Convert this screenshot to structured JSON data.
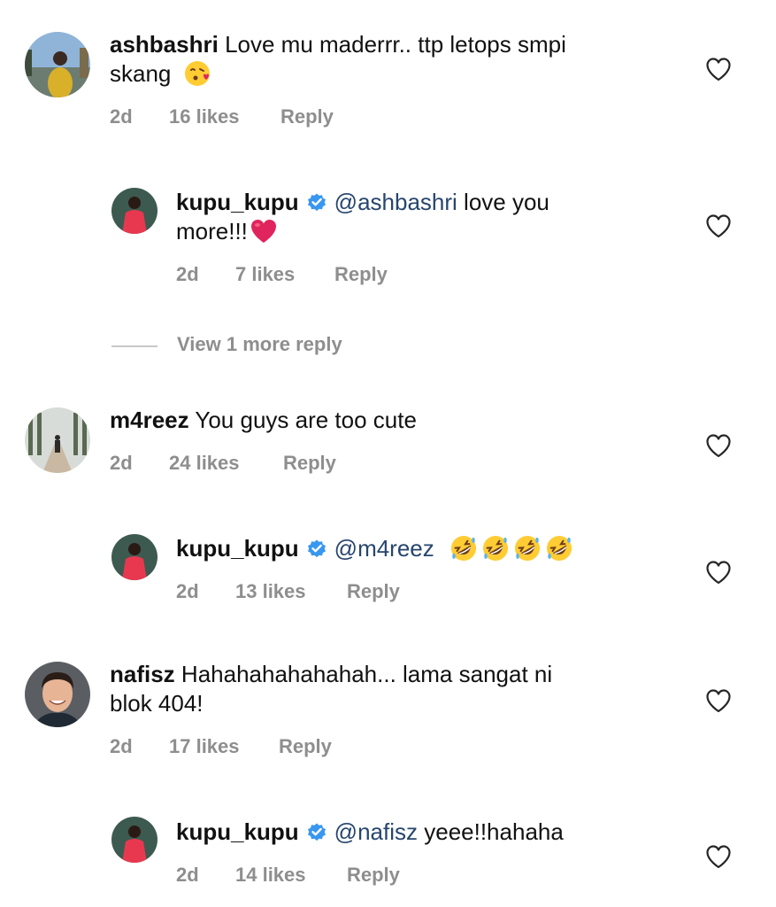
{
  "icons": {
    "like": "heart-outline-icon",
    "verified": "verified-badge-icon"
  },
  "colors": {
    "mention": "#26456e",
    "meta": "#8e8e8e",
    "verified_badge": "#3897f0",
    "emoji_heart": "#e0245e"
  },
  "comments": [
    {
      "username": "ashbashri",
      "text_line1": "Love mu maderrr.. ttp letops smpi",
      "text_line2": "skang",
      "emoji": "kissing-heart-emoji",
      "time": "2d",
      "likes": "16 likes",
      "reply": "Reply"
    },
    {
      "username": "kupu_kupu",
      "verified": true,
      "mention": "@ashbashri",
      "text_line1": "love you",
      "text_line2": "more!!!",
      "emoji": "red-heart-emoji",
      "time": "2d",
      "likes": "7 likes",
      "reply": "Reply"
    },
    {
      "username": "m4reez",
      "text_line1": "You guys are too cute",
      "time": "2d",
      "likes": "24 likes",
      "reply": "Reply"
    },
    {
      "username": "kupu_kupu",
      "verified": true,
      "mention": "@m4reez",
      "emoji": "rolling-on-floor-laughing-emoji",
      "emoji_count": 4,
      "time": "2d",
      "likes": "13 likes",
      "reply": "Reply"
    },
    {
      "username": "nafisz",
      "text_line1": "Hahahahahahahah... lama sangat ni",
      "text_line2": "blok 404!",
      "time": "2d",
      "likes": "17 likes",
      "reply": "Reply"
    },
    {
      "username": "kupu_kupu",
      "verified": true,
      "mention": "@nafisz",
      "text_line1": "yeee!!hahaha",
      "time": "2d",
      "likes": "14 likes",
      "reply": "Reply"
    }
  ],
  "view_more_replies": "View 1 more reply"
}
